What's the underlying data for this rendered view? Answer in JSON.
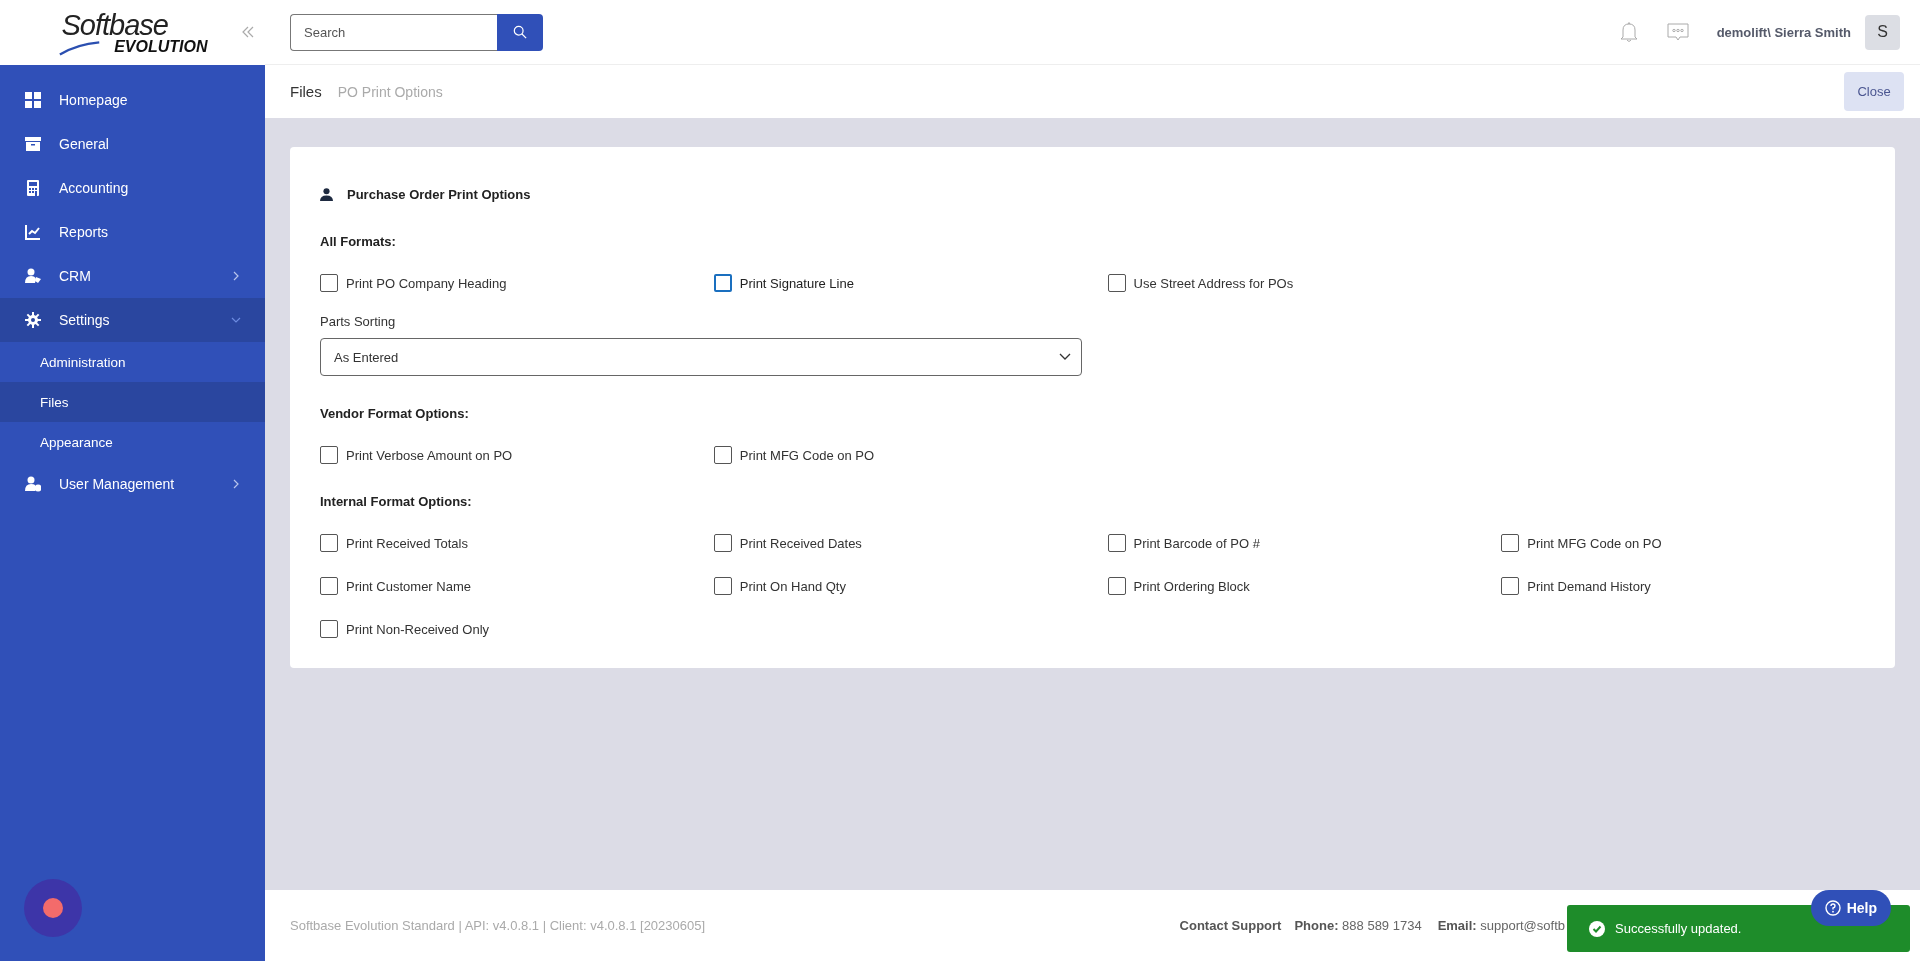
{
  "logo": {
    "word": "Softbase",
    "subword": "EVOLUTION"
  },
  "sidebar": {
    "items": [
      {
        "label": "Homepage",
        "selected": false
      },
      {
        "label": "General",
        "selected": false
      },
      {
        "label": "Accounting",
        "selected": false
      },
      {
        "label": "Reports",
        "selected": false
      },
      {
        "label": "CRM",
        "selected": false,
        "expanded": false
      },
      {
        "label": "Settings",
        "selected": true,
        "expanded": true,
        "children": [
          {
            "label": "Administration",
            "selected": false
          },
          {
            "label": "Files",
            "selected": true
          },
          {
            "label": "Appearance",
            "selected": false
          }
        ]
      },
      {
        "label": "User Management",
        "selected": false,
        "expanded": false
      }
    ]
  },
  "search": {
    "placeholder": "Search"
  },
  "user": {
    "name": "demolift\\ Sierra Smith",
    "initial": "S"
  },
  "breadcrumb": {
    "current": "Files",
    "page": "PO Print Options"
  },
  "close_button": "Close",
  "card": {
    "title": "Purchase Order Print Options",
    "sections": [
      {
        "heading": "All Formats:",
        "checkboxes": [
          {
            "label": "Print PO Company Heading",
            "checked": false,
            "focused": false
          },
          {
            "label": "Print Signature Line",
            "checked": false,
            "focused": true
          },
          {
            "label": "Use Street Address for POs",
            "checked": false,
            "focused": false
          }
        ],
        "select": {
          "label": "Parts Sorting",
          "value": "As Entered"
        }
      },
      {
        "heading": "Vendor Format Options:",
        "checkboxes": [
          {
            "label": "Print Verbose Amount on PO",
            "checked": false
          },
          {
            "label": "Print MFG Code on PO",
            "checked": false
          }
        ]
      },
      {
        "heading": "Internal Format Options:",
        "checkboxes": [
          {
            "label": "Print Received Totals",
            "checked": false
          },
          {
            "label": "Print Received Dates",
            "checked": false
          },
          {
            "label": "Print Barcode of PO #",
            "checked": false
          },
          {
            "label": "Print MFG Code on PO",
            "checked": false
          },
          {
            "label": "Print Customer Name",
            "checked": false
          },
          {
            "label": "Print On Hand Qty",
            "checked": false
          },
          {
            "label": "Print Ordering Block",
            "checked": false
          },
          {
            "label": "Print Demand History",
            "checked": false
          },
          {
            "label": "Print Non-Received Only",
            "checked": false
          }
        ]
      }
    ]
  },
  "footer": {
    "version": "Softbase Evolution Standard | API: v4.0.8.1 | Client: v4.0.8.1 [20230605]",
    "contact": "Contact Support",
    "phone_label": "Phone:",
    "phone": "888 589 1734",
    "email_label": "Email:",
    "email": "support@softb"
  },
  "toast": {
    "message": "Successfully updated."
  },
  "help_button": "Help"
}
